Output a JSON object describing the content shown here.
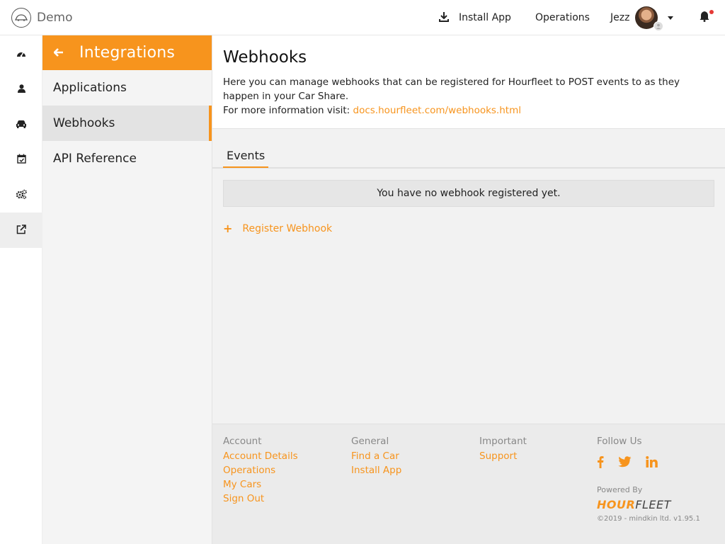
{
  "brand": {
    "name": "Demo"
  },
  "topnav": {
    "install_label": "Install App",
    "operations_label": "Operations",
    "user_name": "Jezz"
  },
  "rail": {
    "items": [
      {
        "icon": "dashboard-icon"
      },
      {
        "icon": "user-icon"
      },
      {
        "icon": "car-icon"
      },
      {
        "icon": "calendar-check-icon"
      },
      {
        "icon": "cogs-icon"
      },
      {
        "icon": "external-link-icon"
      }
    ],
    "active_index": 5
  },
  "sidebar": {
    "title": "Integrations",
    "items": [
      {
        "label": "Applications"
      },
      {
        "label": "Webhooks"
      },
      {
        "label": "API Reference"
      }
    ],
    "active_index": 1
  },
  "main": {
    "title": "Webhooks",
    "description": "Here you can manage webhooks that can be registered for Hourfleet to POST events to as they happen in your Car Share.",
    "more_info_prefix": "For more information visit: ",
    "more_info_link": "docs.hourfleet.com/webhooks.html",
    "tab": "Events",
    "empty_message": "You have no webhook registered yet.",
    "register_label": "Register Webhook"
  },
  "footer": {
    "account": {
      "heading": "Account",
      "links": [
        "Account Details",
        "Operations",
        "My Cars",
        "Sign Out"
      ]
    },
    "general": {
      "heading": "General",
      "links": [
        "Find a Car",
        "Install App"
      ]
    },
    "important": {
      "heading": "Important",
      "links": [
        "Support"
      ]
    },
    "follow": {
      "heading": "Follow Us",
      "icons": [
        "facebook-icon",
        "twitter-icon",
        "linkedin-icon"
      ]
    },
    "powered_by": "Powered By",
    "logo_hour": "HOUR",
    "logo_fleet": "FLEET",
    "copyright": "©2019 - mindkin ltd. v1.95.1"
  },
  "colors": {
    "accent": "#f7941d",
    "notification": "#e53935"
  }
}
